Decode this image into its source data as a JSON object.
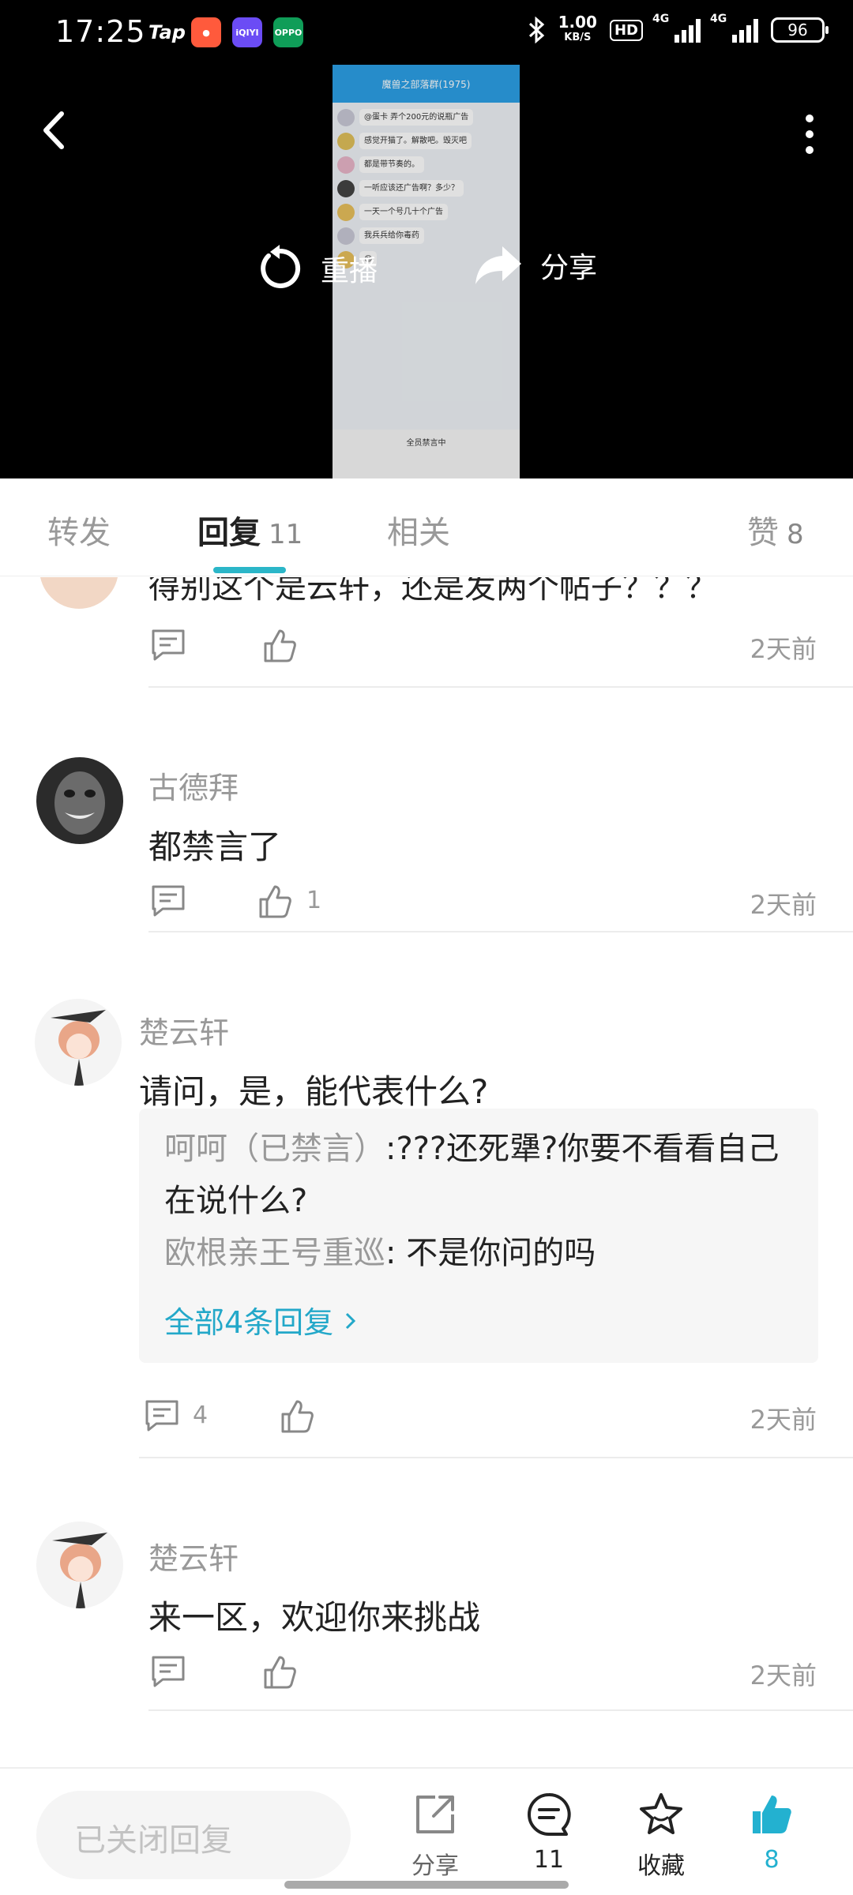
{
  "status_bar": {
    "time": "17:25",
    "apps": [
      {
        "name": "Tap",
        "color": "#000000"
      },
      {
        "name": "",
        "color": "#ff5a3c"
      },
      {
        "name": "iQIYI",
        "color": "#00c03a"
      },
      {
        "name": "OPPO",
        "color": "#0f9d58"
      }
    ],
    "net_speed": "1.00",
    "net_unit": "KB/S",
    "hd": "HD",
    "signal1": "4G",
    "signal2": "4G",
    "battery": "96"
  },
  "video": {
    "replay_label": "重播",
    "share_label": "分享",
    "frame_title": "魔兽之部落群(1975)",
    "frame_messages": [
      "@蛋卡 弄个200元的说瓶广告",
      "感觉开猫了。解散吧。毁灭吧",
      "都是带节奏的。",
      "一听应该还广告啊？多少？",
      "一天一个号几十个广告",
      "我兵兵给你毒药",
      "😊"
    ],
    "frame_bottom": "全员禁言中"
  },
  "tabs": {
    "forward": "转发",
    "reply": "回复",
    "reply_count": "11",
    "related": "相关",
    "like": "赞",
    "like_count": "8"
  },
  "comments": {
    "cut_text": "得别这个是云轩，还是发两个帖子？？？",
    "cut_time": "2天前",
    "items": [
      {
        "name": "古德拜",
        "text": "都禁言了",
        "likes": "1",
        "time": "2天前"
      },
      {
        "name": "楚云轩",
        "text": "请问，是，能代表什么?",
        "replies_count": "4",
        "time": "2天前",
        "sub_replies": [
          {
            "who": "呵呵（已禁言）",
            "text": ":???还死犟?你要不看看自己在说什么?"
          },
          {
            "who": "欧根亲王号重巡",
            "text": ": 不是你问的吗"
          }
        ],
        "more_link": "全部4条回复"
      },
      {
        "name": "楚云轩",
        "text": "来一区，欢迎你来挑战",
        "time": "2天前"
      }
    ]
  },
  "bottom_bar": {
    "reply_placeholder": "已关闭回复",
    "share": "分享",
    "comments_count": "11",
    "favorite": "收藏",
    "likes_count": "8",
    "accent_color": "#23b1d0"
  }
}
